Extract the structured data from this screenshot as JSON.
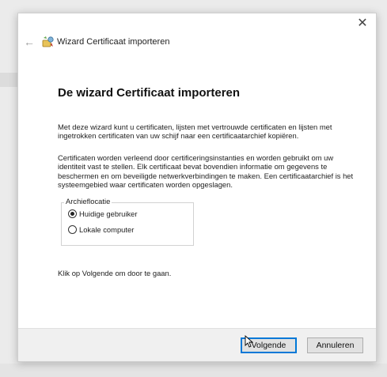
{
  "window": {
    "title": "Wizard Certificaat importeren",
    "close_glyph": "✕",
    "back_glyph": "←"
  },
  "content": {
    "heading": "De wizard Certificaat importeren",
    "intro": "Met deze wizard kunt u certificaten, lijsten met vertrouwde certificaten en lijsten met ingetrokken certificaten van uw schijf naar een certificaatarchief kopiëren.",
    "description": "Certificaten worden verleend door certificeringsinstanties en worden gebruikt om uw identiteit vast te stellen. Elk certificaat bevat bovendien informatie om gegevens te beschermen en om beveiligde netwerkverbindingen te maken. Een certificaatarchief is het systeemgebied waar certificaten worden opgeslagen.",
    "store_location": {
      "label": "Archieflocatie",
      "options": [
        {
          "label": "Huidige gebruiker",
          "selected": true
        },
        {
          "label": "Lokale computer",
          "selected": false
        }
      ]
    },
    "instruction": "Klik op Volgende om door te gaan."
  },
  "footer": {
    "next_label": "Volgende",
    "cancel_label": "Annuleren"
  },
  "icons": {
    "back": "back-arrow-icon",
    "wizard": "certificate-wizard-icon",
    "close": "close-icon",
    "cursor": "mouse-cursor-icon"
  },
  "colors": {
    "focus_border": "#0078d7",
    "footer_bg": "#f0f0f0",
    "button_bg": "#e1e1e1"
  }
}
